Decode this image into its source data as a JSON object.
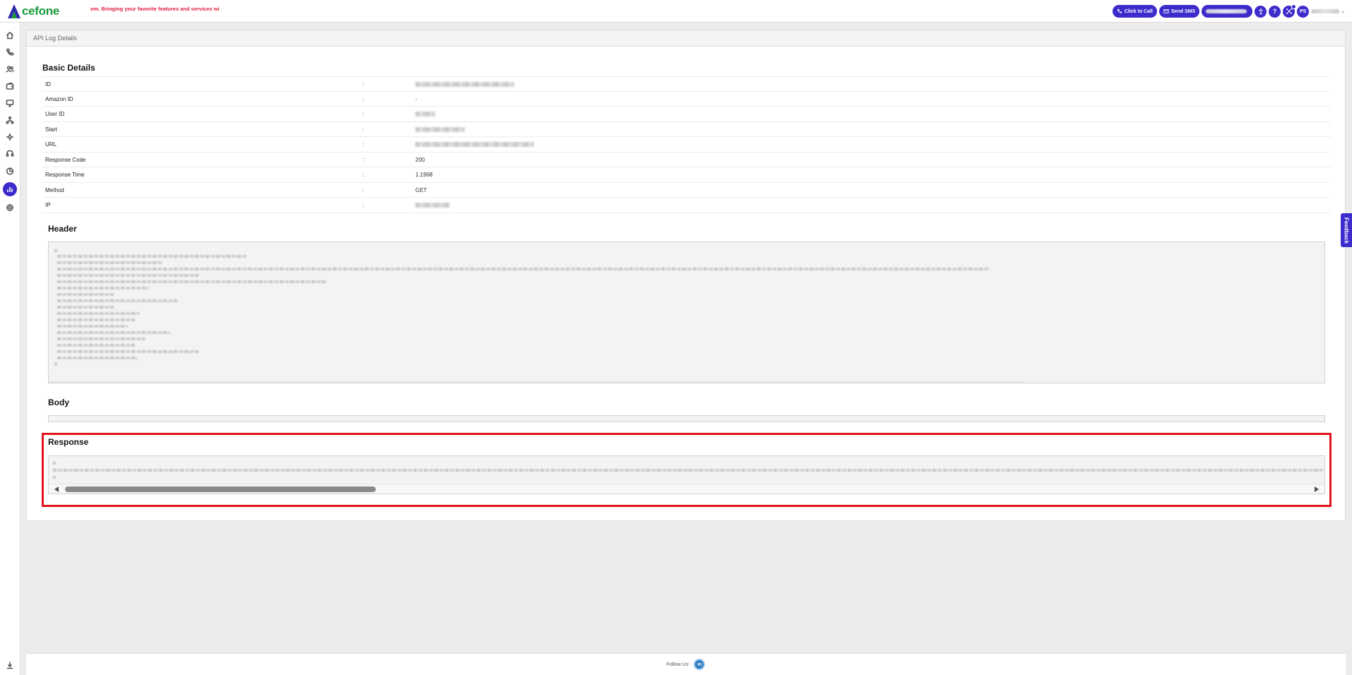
{
  "brand": {
    "logo_text": "cefone",
    "brand_color": "#1a9a3a",
    "accent_color": "#3d2bcc"
  },
  "marquee": {
    "text": "om. Bringing your favorite features and services with a ne"
  },
  "topbar": {
    "click_to_call_label": "Click to Call",
    "send_sms_label": "Send SMS",
    "help_label": "?",
    "avatar_initials": "PS"
  },
  "sidebar": {
    "items": [
      {
        "icon": "home-icon"
      },
      {
        "icon": "phone-icon"
      },
      {
        "icon": "users-icon"
      },
      {
        "icon": "wallet-icon"
      },
      {
        "icon": "monitor-icon"
      },
      {
        "icon": "network-icon"
      },
      {
        "icon": "integration-icon"
      },
      {
        "icon": "headset-icon"
      },
      {
        "icon": "pie-chart-icon"
      },
      {
        "icon": "bar-chart-icon",
        "active": true
      },
      {
        "icon": "settings-icon"
      },
      {
        "icon": "download-icon"
      }
    ]
  },
  "page": {
    "breadcrumb": "API Log Details",
    "basic_details_title": "Basic Details",
    "rows": [
      {
        "label": "ID",
        "value": ""
      },
      {
        "label": "Amazon ID",
        "value": "-"
      },
      {
        "label": "User ID",
        "value": ""
      },
      {
        "label": "Start",
        "value": ""
      },
      {
        "label": "URL",
        "value": ""
      },
      {
        "label": "Response Code",
        "value": "200"
      },
      {
        "label": "Response Time",
        "value": "1.1968"
      },
      {
        "label": "Method",
        "value": "GET"
      },
      {
        "label": "IP",
        "value": ""
      }
    ],
    "colon": ":",
    "header_title": "Header",
    "body_title": "Body",
    "response_title": "Response"
  },
  "feedback": {
    "label": "Feedback"
  },
  "footer": {
    "follow_us": "Follow Us:",
    "linkedin_label": "in"
  }
}
